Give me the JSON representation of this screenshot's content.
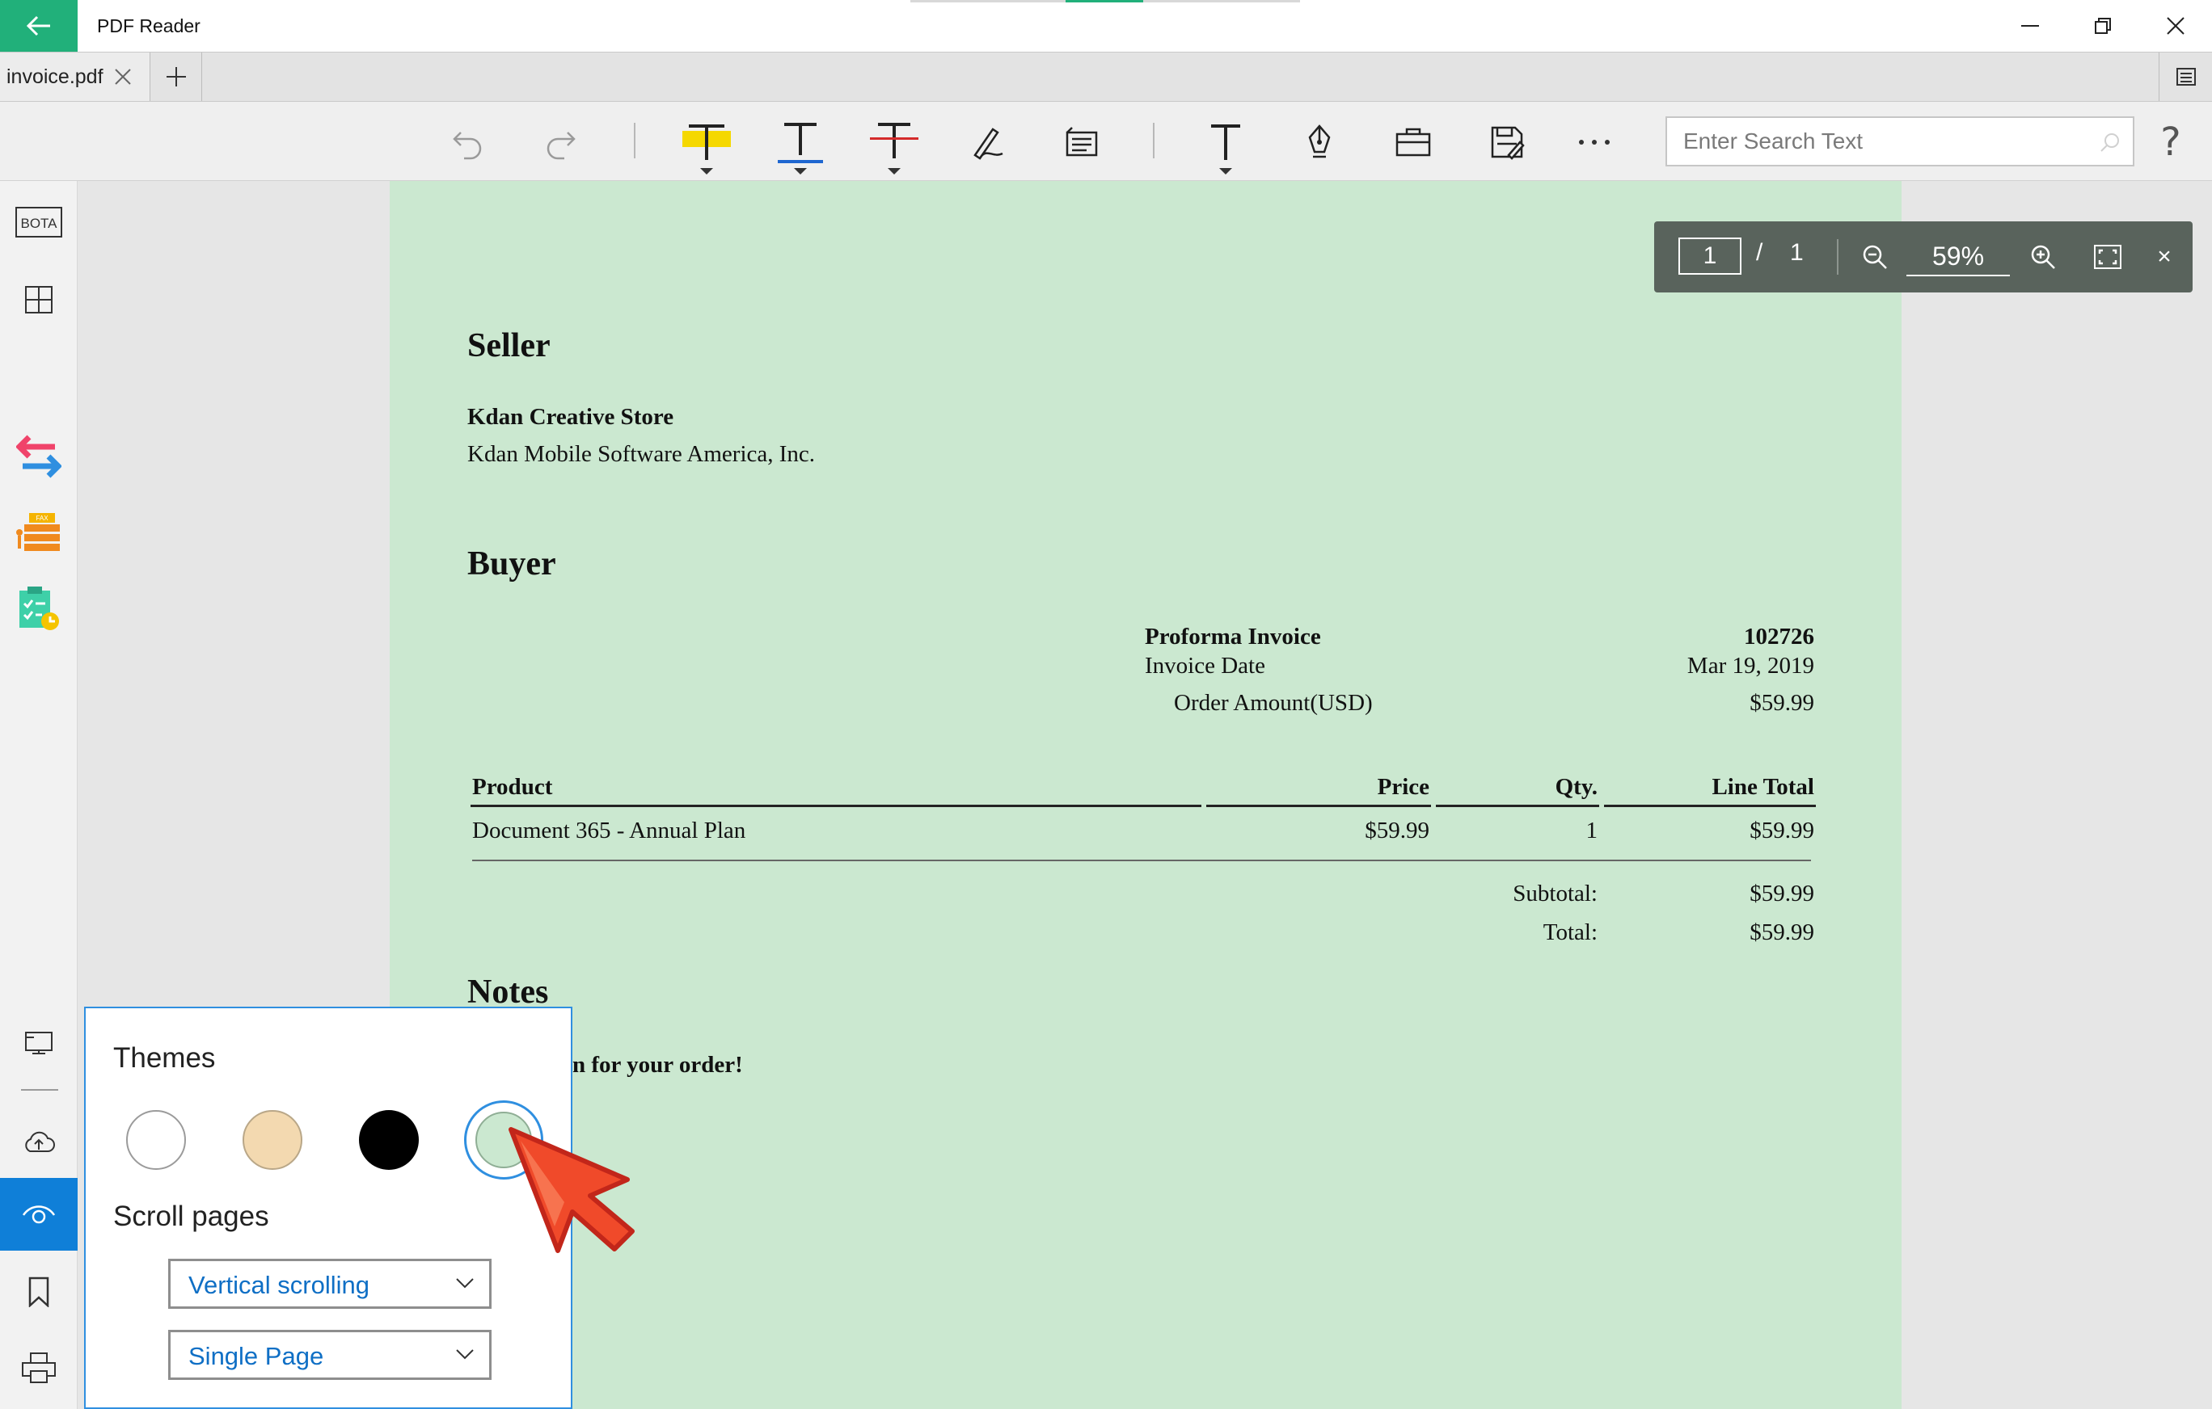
{
  "app": {
    "title": "PDF Reader"
  },
  "tabs": [
    {
      "label": "invoice.pdf"
    }
  ],
  "search": {
    "placeholder": "Enter Search Text"
  },
  "help": {
    "label": "?"
  },
  "sidebar": {
    "bota_label": "BOTA",
    "active_item": "view"
  },
  "zoom_toolbar": {
    "current_page": "1",
    "separator": "/",
    "total_pages": "1",
    "zoom_level": "59%",
    "close_label": "×"
  },
  "invoice": {
    "seller_heading": "Seller",
    "seller_name": "Kdan Creative Store",
    "seller_company": "Kdan Mobile Software America, Inc.",
    "buyer_heading": "Buyer",
    "meta": [
      {
        "label": "Proforma Invoice",
        "value": "102726"
      },
      {
        "label": "Invoice Date",
        "value": "Mar 19, 2019"
      },
      {
        "label": "Order Amount(USD)",
        "value": "$59.99"
      }
    ],
    "table": {
      "headers": {
        "product": "Product",
        "price": "Price",
        "qty": "Qty.",
        "line_total": "Line Total"
      },
      "rows": [
        {
          "product": "Document 365 - Annual Plan",
          "price": "$59.99",
          "qty": "1",
          "line_total": "$59.99"
        }
      ]
    },
    "subtotal_label": "Subtotal:",
    "subtotal_value": "$59.99",
    "total_label": "Total:",
    "total_value": "$59.99",
    "notes_heading": "Notes",
    "notes_text": "n for your order!"
  },
  "theme_popup": {
    "themes_title": "Themes",
    "themes": [
      {
        "name": "white",
        "color": "#ffffff"
      },
      {
        "name": "beige",
        "color": "#f3d9b0"
      },
      {
        "name": "black",
        "color": "#000000"
      },
      {
        "name": "green",
        "color": "#cbe8d0",
        "selected": true
      }
    ],
    "scroll_title": "Scroll pages",
    "scroll_mode": "Vertical scrolling",
    "page_mode": "Single Page"
  },
  "colors": {
    "accent": "#21b07a",
    "sidebar_active": "#0f7fd8",
    "page_background": "#cbe8d0",
    "highlight_yellow": "#f5d800",
    "underline_blue": "#1e66d0",
    "strike_red": "#d42a2a"
  }
}
